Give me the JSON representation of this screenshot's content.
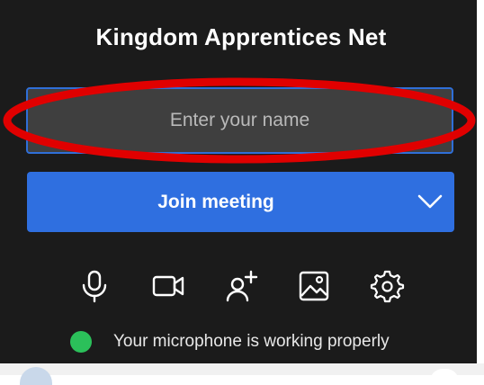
{
  "header": {
    "title": "Kingdom Apprentices Net"
  },
  "name_field": {
    "placeholder": "Enter your name",
    "value": ""
  },
  "join": {
    "label": "Join meeting"
  },
  "toolbar": {
    "icons": [
      "microphone-icon",
      "video-camera-icon",
      "invite-person-icon",
      "background-image-icon",
      "settings-gear-icon"
    ]
  },
  "status": {
    "text": "Your microphone is working properly",
    "dot_color": "#2bc05a"
  },
  "colors": {
    "background": "#1b1b1b",
    "accent": "#2f6fe0",
    "highlight": "#e00000"
  }
}
